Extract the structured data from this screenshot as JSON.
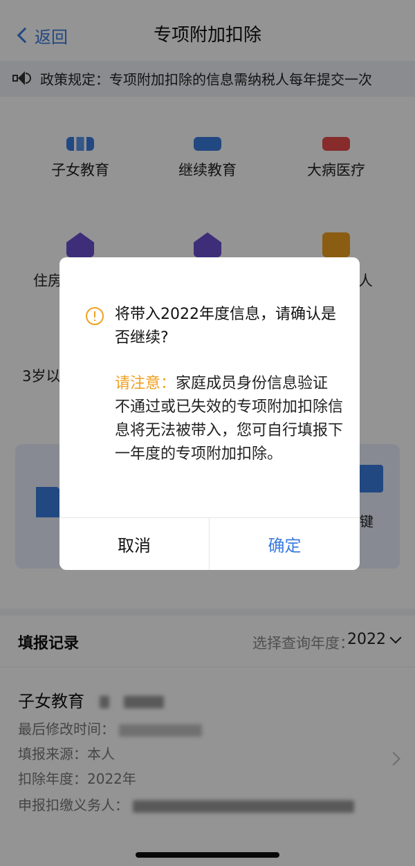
{
  "nav": {
    "back_label": "返回",
    "title": "专项附加扣除"
  },
  "notice": {
    "text": "政策规定：专项附加扣除的信息需纳税人每年提交一次"
  },
  "categories": [
    {
      "label": "子女教育",
      "icon": "books-icon"
    },
    {
      "label": "继续教育",
      "icon": "graduation-cap-icon"
    },
    {
      "label": "大病医疗",
      "icon": "medical-kit-icon"
    }
  ],
  "partial_labels": {
    "row2_left": "住房",
    "row2_right": "人",
    "row3_left": "3岁以"
  },
  "banner": {
    "right_text": "键"
  },
  "records": {
    "title": "填报记录",
    "year_label": "选择查询年度：",
    "year_value": "2022",
    "item": {
      "title": "子女教育",
      "modified_label": "最后修改时间：",
      "source_line": "填报来源：本人",
      "year_line": "扣除年度：2022年",
      "agent_label": "申报扣缴义务人："
    }
  },
  "dialog": {
    "message": "将带入2022年度信息，请确认是否继续?",
    "note_label": "请注意：",
    "note_text": "家庭成员身份信息验证不通过或已失效的专项附加扣除信息将无法被带入，您可自行填报下一年度的专项附加扣除。",
    "cancel_label": "取消",
    "confirm_label": "确定",
    "accent_color": "#3b7de0",
    "warning_color": "#f0a020"
  }
}
